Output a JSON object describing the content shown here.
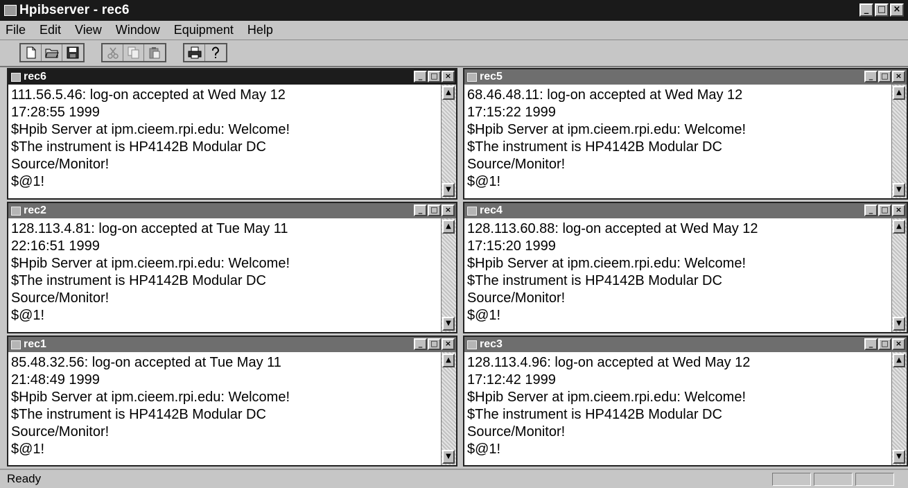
{
  "app": {
    "title": "Hpibserver - rec6"
  },
  "window_controls": {
    "minimize": "_",
    "maximize": "□",
    "close": "×"
  },
  "menu": [
    "File",
    "Edit",
    "View",
    "Window",
    "Equipment",
    "Help"
  ],
  "toolbar": {
    "group1": [
      "new-doc-icon",
      "open-folder-icon",
      "save-disk-icon"
    ],
    "group2": [
      "cut-icon",
      "copy-icon",
      "paste-icon"
    ],
    "group3": [
      "print-icon",
      "help-icon"
    ]
  },
  "windows": [
    {
      "title": "rec6",
      "lines": [
        "111.56.5.46: log-on accepted at Wed May 12",
        "17:28:55 1999",
        "$Hpib Server at ipm.cieem.rpi.edu: Welcome!",
        "$The instrument is HP4142B Modular DC",
        "Source/Monitor!",
        "$@1!"
      ]
    },
    {
      "title": "rec5",
      "lines": [
        "68.46.48.11: log-on accepted at Wed May 12",
        "17:15:22 1999",
        "$Hpib Server at ipm.cieem.rpi.edu: Welcome!",
        "$The instrument is HP4142B Modular DC",
        "Source/Monitor!",
        "$@1!"
      ]
    },
    {
      "title": "rec2",
      "lines": [
        "128.113.4.81: log-on accepted at Tue May 11",
        "22:16:51 1999",
        "$Hpib Server at ipm.cieem.rpi.edu: Welcome!",
        "$The instrument is HP4142B Modular DC",
        "Source/Monitor!",
        "$@1!"
      ]
    },
    {
      "title": "rec4",
      "lines": [
        "128.113.60.88: log-on accepted at Wed May 12",
        "17:15:20 1999",
        "$Hpib Server at ipm.cieem.rpi.edu: Welcome!",
        "$The instrument is HP4142B Modular DC",
        "Source/Monitor!",
        "$@1!"
      ]
    },
    {
      "title": "rec1",
      "lines": [
        "85.48.32.56: log-on accepted at Tue May 11",
        "21:48:49 1999",
        "$Hpib Server at ipm.cieem.rpi.edu: Welcome!",
        "$The instrument is HP4142B Modular DC",
        "Source/Monitor!",
        "$@1!"
      ]
    },
    {
      "title": "rec3",
      "lines": [
        "128.113.4.96: log-on accepted at Wed May 12",
        "17:12:42 1999",
        "$Hpib Server at ipm.cieem.rpi.edu: Welcome!",
        "$The instrument is HP4142B Modular DC",
        "Source/Monitor!",
        "$@1!"
      ]
    }
  ],
  "status": {
    "text": "Ready"
  }
}
